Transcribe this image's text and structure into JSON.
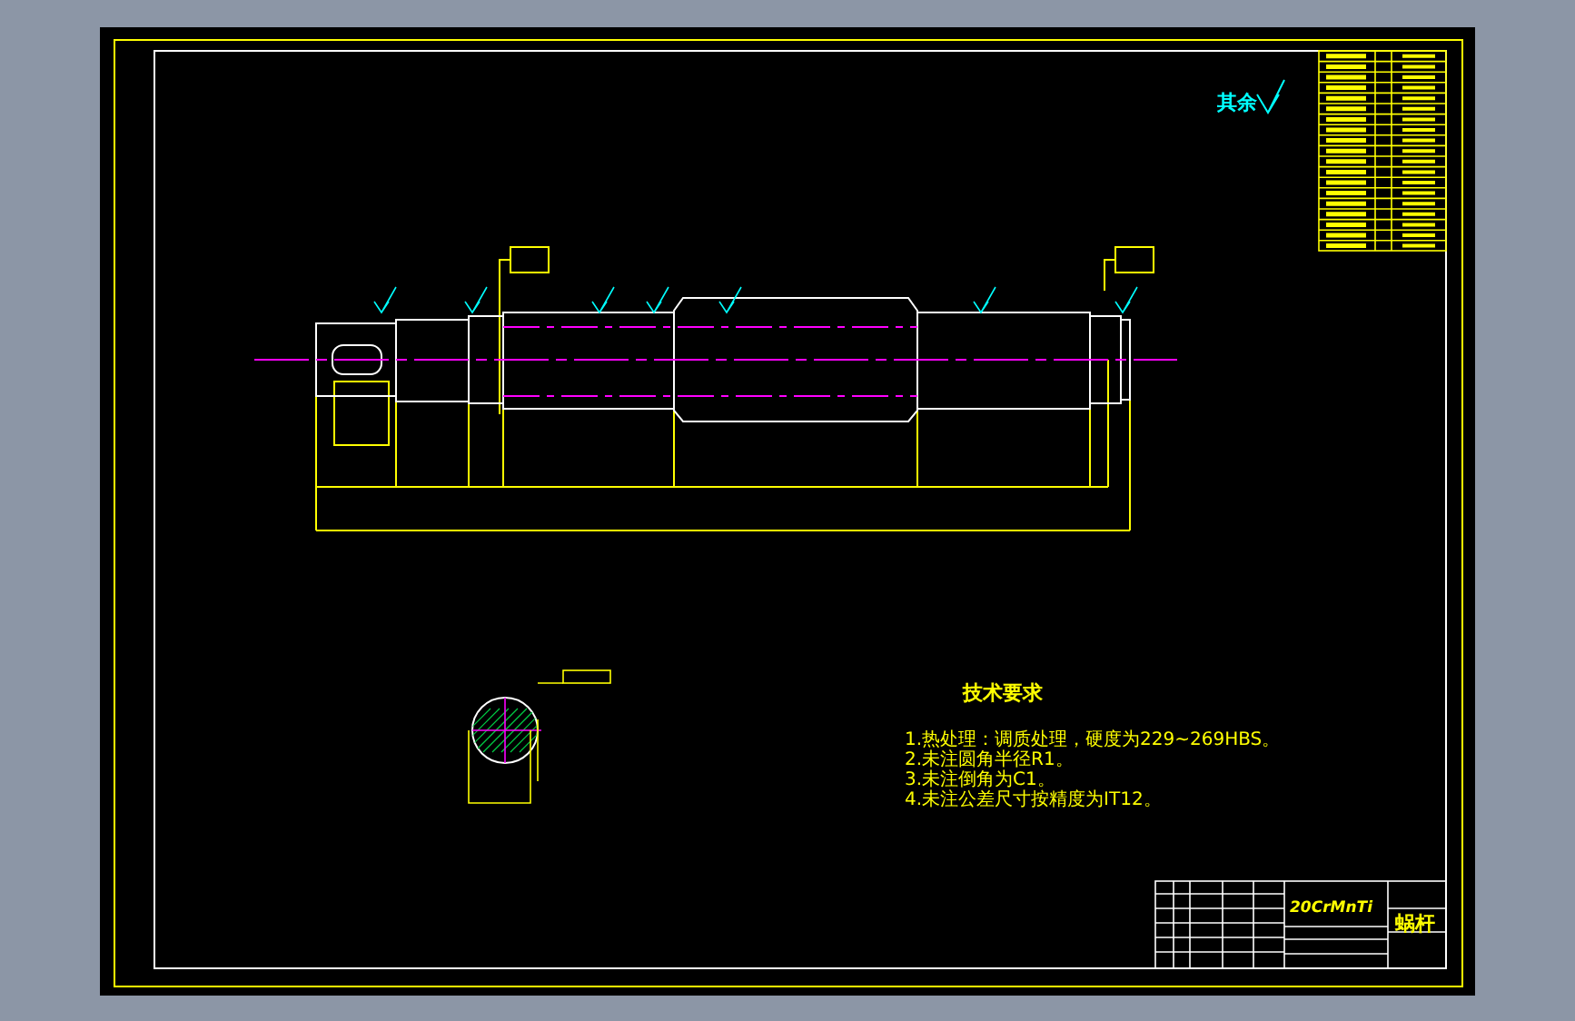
{
  "roughness_note": {
    "label": "其余"
  },
  "technical_requirements": {
    "heading": "技术要求",
    "items": [
      "1.热处理：调质处理，硬度为229~269HBS。",
      "2.未注圆角半径R1。",
      "3.未注倒角为C1。",
      "4.未注公差尺寸按精度为IT12。"
    ]
  },
  "title_block": {
    "material": "20CrMnTi",
    "part_name": "蜗杆"
  }
}
